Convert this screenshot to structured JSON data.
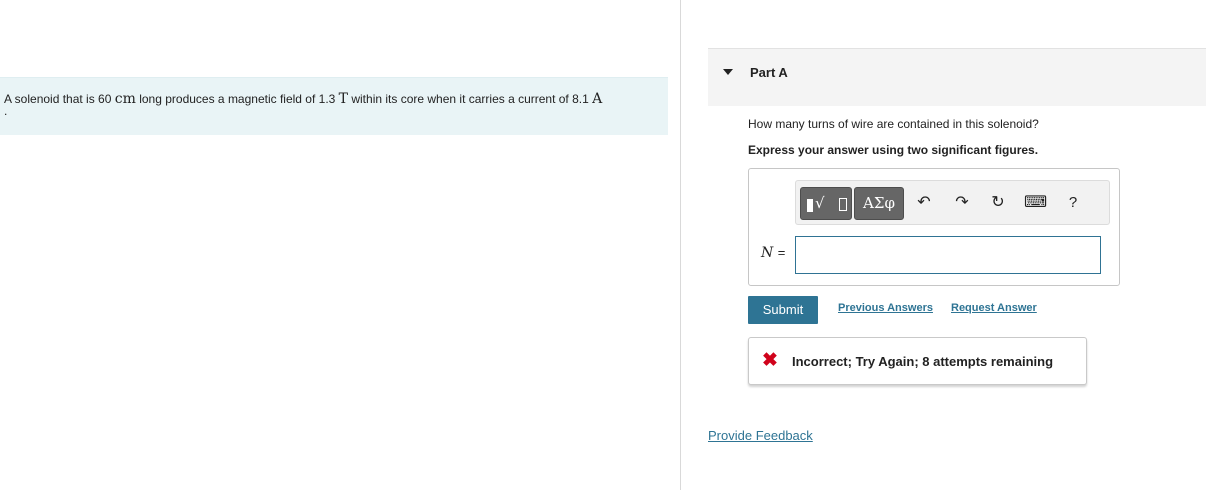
{
  "problem": {
    "text_1": "A solenoid that is 60 ",
    "unit_length": "cm",
    "text_2": " long produces a magnetic field of 1.3 ",
    "unit_field": "T",
    "text_3": " within its core when it carries a current of 8.1 ",
    "unit_current": "A",
    "text_end": "."
  },
  "part": {
    "title": "Part A",
    "question": "How many turns of wire are contained in this solenoid?",
    "instruction": "Express your answer using two significant figures."
  },
  "toolbar": {
    "greek_label": "ΑΣφ",
    "undo_glyph": "↶",
    "redo_glyph": "↷",
    "reset_glyph": "↻",
    "keyboard_glyph": "⌨",
    "help_label": "?",
    "icons": [
      "templates-icon",
      "greek-symbols-icon",
      "undo-icon",
      "redo-icon",
      "reset-icon",
      "keyboard-icon",
      "help-icon"
    ]
  },
  "answer": {
    "variable": "N",
    "equals": "=",
    "value": ""
  },
  "actions": {
    "submit_label": "Submit",
    "previous_answers_label": "Previous Answers",
    "request_answer_label": "Request Answer"
  },
  "feedback": {
    "icon": "✖",
    "message": "Incorrect; Try Again; 8 attempts remaining"
  },
  "footer": {
    "provide_feedback_label": "Provide Feedback"
  },
  "colors": {
    "accent": "#2e7494",
    "problem_bg": "#e9f4f6",
    "error": "#d0021b"
  }
}
